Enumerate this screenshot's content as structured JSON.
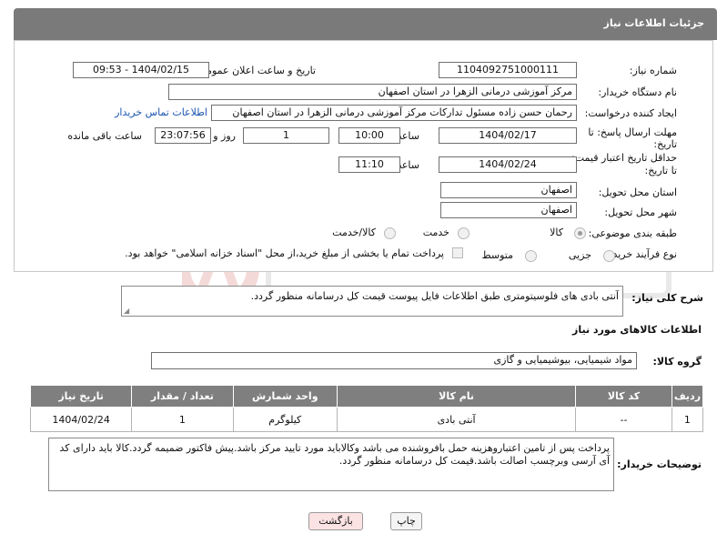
{
  "header": {
    "title": "جزئیات اطلاعات نیاز"
  },
  "form": {
    "need_number_label": "شماره نیاز:",
    "need_number": "1104092751000111",
    "announce_label": "تاریخ و ساعت اعلان عمومی:",
    "announce_value": "1404/02/15 - 09:53",
    "buyer_org_label": "نام دستگاه خریدار:",
    "buyer_org": "مرکز آموزشی درمانی الزهرا در استان اصفهان",
    "creator_label": "ایجاد کننده درخواست:",
    "creator": "رحمان حسن زاده مسئول تدارکات مرکز آموزشی درمانی الزهرا در استان اصفهان",
    "contact_link": "اطلاعات تماس خریدار",
    "deadline_label_1": "مهلت ارسال پاسخ: تا",
    "deadline_label_2": "تاریخ:",
    "deadline_date": "1404/02/17",
    "time_label": "ساعت",
    "deadline_time": "10:00",
    "days_value": "1",
    "days_label": "روز و",
    "remaining_value": "23:07:56",
    "remaining_label": "ساعت باقی مانده",
    "min_validity_label_1": "حداقل تاریخ اعتبار قیمت:",
    "min_validity_label_2": "تا تاریخ:",
    "validity_date": "1404/02/24",
    "validity_time": "11:10",
    "province_label": "استان محل تحویل:",
    "province": "اصفهان",
    "city_label": "شهر محل تحویل:",
    "city": "اصفهان",
    "category_label": "طبقه بندی موضوعی:",
    "category_options": [
      "کالا",
      "خدمت",
      "کالا/خدمت"
    ],
    "process_label": "نوع فرآیند خرید :",
    "process_options": [
      "جزیی",
      "متوسط"
    ],
    "payment_note": "پرداخت تمام یا بخشی از مبلغ خرید،از محل \"اسناد خزانه اسلامی\" خواهد بود."
  },
  "description": {
    "label": "شرح کلی نیاز:",
    "text": "آنتی بادی های فلوسیتومتری طبق اطلاعات فایل پیوست قیمت کل درسامانه منظور گردد."
  },
  "goods": {
    "section_title": "اطلاعات کالاهای مورد نیاز",
    "group_label": "گروه کالا:",
    "group_value": "مواد شیمیایی، بیوشیمیایی و  گازی",
    "columns": [
      "ردیف",
      "کد کالا",
      "نام کالا",
      "واحد شمارش",
      "تعداد / مقدار",
      "تاریخ نیاز"
    ],
    "rows": [
      [
        "1",
        "--",
        "آنتی بادی",
        "کیلوگرم",
        "1",
        "1404/02/24"
      ]
    ]
  },
  "buyer_notes": {
    "label": "توضیحات خریدار:",
    "text": "پرداخت پس از تامین اعتباروهزینه حمل بافروشنده می باشد وکالاباید مورد تایید مرکز باشد.پیش فاکتور ضمیمه گردد.کالا باید دارای کد آی آرسی وبرچسب اصالت باشد.قیمت کل درسامانه منظور گردد."
  },
  "buttons": {
    "print": "چاپ",
    "back": "بازگشت"
  },
  "colors": {
    "header_bg": "#7a7a7a",
    "table_header_bg": "#7f7f7f",
    "link": "#1a55b0",
    "back_button_bg": "#fbe3e3"
  }
}
